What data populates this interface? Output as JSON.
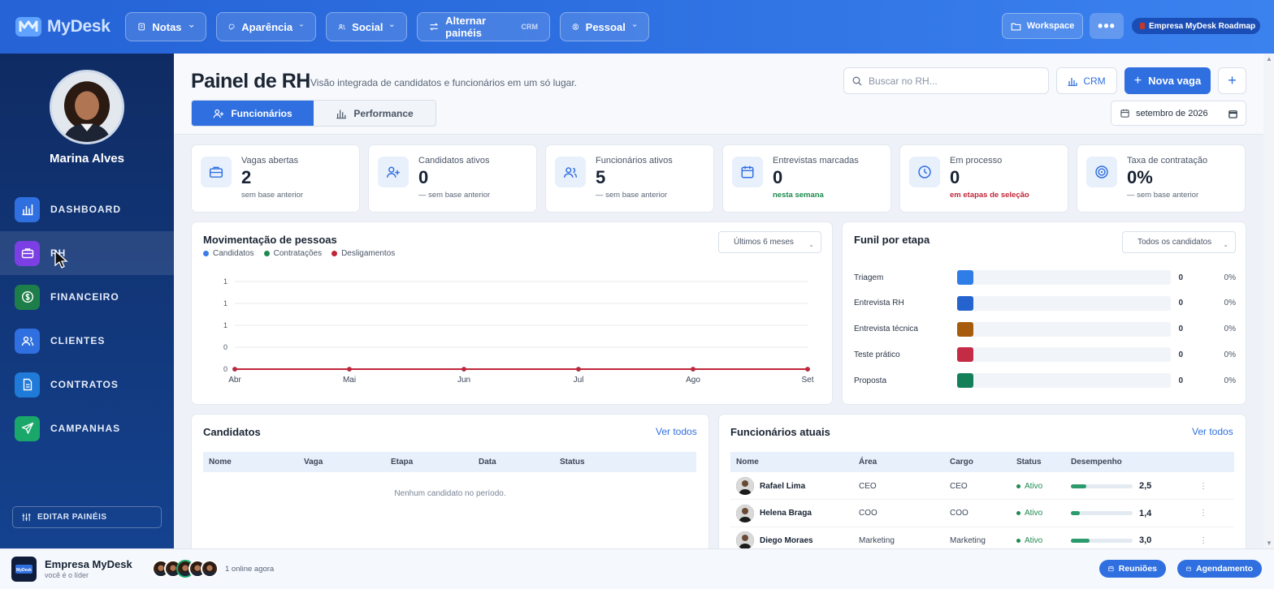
{
  "brand": {
    "name": "MyDesk"
  },
  "topnav": {
    "items": [
      {
        "label": "Notas",
        "icon": "notes-icon"
      },
      {
        "label": "Aparência",
        "icon": "palette-icon"
      },
      {
        "label": "Social",
        "icon": "users-icon"
      },
      {
        "label": "Alternar painéis",
        "tag": "CRM",
        "icon": "swap-icon"
      },
      {
        "label": "Pessoal",
        "icon": "person-icon"
      }
    ],
    "workspace": "Workspace",
    "more": "•••",
    "company_badge": "Empresa MyDesk Roadmap"
  },
  "sidebar": {
    "user_name": "Marina Alves",
    "items": [
      {
        "label": "DASHBOARD",
        "color": "#2f6fe0",
        "icon": "chart-icon"
      },
      {
        "label": "RH",
        "color": "#7b3fe4",
        "icon": "briefcase-icon"
      },
      {
        "label": "FINANCEIRO",
        "color": "#1e7e4a",
        "icon": "dollar-icon"
      },
      {
        "label": "CLIENTES",
        "color": "#2f6fe0",
        "icon": "users-icon"
      },
      {
        "label": "CONTRATOS",
        "color": "#1f7ad8",
        "icon": "document-icon"
      },
      {
        "label": "CAMPANHAS",
        "color": "#1aa86a",
        "icon": "send-icon"
      }
    ],
    "edit_label": "EDITAR PAINÉIS"
  },
  "page": {
    "title": "Painel de RH",
    "subtitle": "Visão integrada de candidatos e funcionários em um só lugar.",
    "tabs": [
      {
        "label": "Funcionários"
      },
      {
        "label": "Performance"
      }
    ],
    "search_placeholder": "Buscar no RH...",
    "crm_label": "CRM",
    "new_label": "Nova vaga",
    "plus_label": "+",
    "month": "setembro de 2026"
  },
  "kpis": [
    {
      "label": "Vagas abertas",
      "value": "2",
      "sub": "sem base anterior",
      "sub_color": "#5b6678",
      "icon": "briefcase-icon"
    },
    {
      "label": "Candidatos ativos",
      "value": "0",
      "sub": "— sem base anterior",
      "sub_color": "#5b6678",
      "icon": "user-plus-icon"
    },
    {
      "label": "Funcionários ativos",
      "value": "5",
      "sub": "— sem base anterior",
      "sub_color": "#5b6678",
      "icon": "users-icon"
    },
    {
      "label": "Entrevistas marcadas",
      "value": "0",
      "sub": "nesta semana",
      "sub_color": "#1d8a4e",
      "icon": "calendar-icon"
    },
    {
      "label": "Em processo",
      "value": "0",
      "sub": "em etapas de seleção",
      "sub_color": "#c0263a",
      "icon": "clock-icon"
    },
    {
      "label": "Taxa de contratação",
      "value": "0%",
      "sub": "— sem base anterior",
      "sub_color": "#5b6678",
      "icon": "target-icon"
    }
  ],
  "movement": {
    "title": "Movimentação de pessoas",
    "range": "Últimos 6 meses",
    "legend": [
      {
        "name": "Candidatos",
        "color": "#3b7de8"
      },
      {
        "name": "Contratações",
        "color": "#1d8a4e"
      },
      {
        "name": "Desligamentos",
        "color": "#c0263a"
      }
    ]
  },
  "chart_data": {
    "type": "line",
    "x": [
      "Abr",
      "Mai",
      "Jun",
      "Jul",
      "Ago",
      "Set"
    ],
    "y_ticks": [
      "0",
      "0",
      "1",
      "1",
      "1"
    ],
    "series": [
      {
        "name": "Candidatos",
        "color": "#3b7de8",
        "values": [
          0,
          0,
          0,
          0,
          0,
          0
        ]
      },
      {
        "name": "Contratações",
        "color": "#1d8a4e",
        "values": [
          0,
          0,
          0,
          0,
          0,
          0
        ]
      },
      {
        "name": "Desligamentos",
        "color": "#c0263a",
        "values": [
          0,
          0,
          0,
          0,
          0,
          0
        ]
      }
    ],
    "grid": true,
    "legend": "top-left"
  },
  "funnel": {
    "title": "Funil por etapa",
    "filter": "Todos os candidatos",
    "stages": [
      {
        "label": "Triagem",
        "count": "0",
        "pct": "0%",
        "color": "#2f7ee8"
      },
      {
        "label": "Entrevista RH",
        "count": "0",
        "pct": "0%",
        "color": "#2563cf"
      },
      {
        "label": "Entrevista técnica",
        "count": "0",
        "pct": "0%",
        "color": "#a65c0c"
      },
      {
        "label": "Teste prático",
        "count": "0",
        "pct": "0%",
        "color": "#c42b45"
      },
      {
        "label": "Proposta",
        "count": "0",
        "pct": "0%",
        "color": "#14805a"
      }
    ]
  },
  "candidates": {
    "title": "Candidatos",
    "see_all": "Ver todos",
    "columns": [
      "Nome",
      "Vaga",
      "Etapa",
      "Data",
      "Status"
    ],
    "empty": "Nenhum candidato no período."
  },
  "employees": {
    "title": "Funcionários atuais",
    "see_all": "Ver todos",
    "columns": [
      "Nome",
      "Área",
      "Cargo",
      "Status",
      "Desempenho"
    ],
    "rows": [
      {
        "name": "Rafael Lima",
        "area": "CEO",
        "role": "CEO",
        "status": "Ativo",
        "score": "2,5",
        "perf": 0.25,
        "menu": "⋮"
      },
      {
        "name": "Helena Braga",
        "area": "COO",
        "role": "COO",
        "status": "Ativo",
        "score": "1,4",
        "perf": 0.14,
        "menu": "⋮"
      },
      {
        "name": "Diego Moraes",
        "area": "Marketing",
        "role": "Marketing",
        "status": "Ativo",
        "score": "3,0",
        "perf": 0.3,
        "menu": "⋮"
      }
    ]
  },
  "footer": {
    "company": "Empresa MyDesk",
    "role": "você é o líder",
    "online": "1 online agora",
    "meetings": "Reuniões",
    "schedule": "Agendamento"
  }
}
